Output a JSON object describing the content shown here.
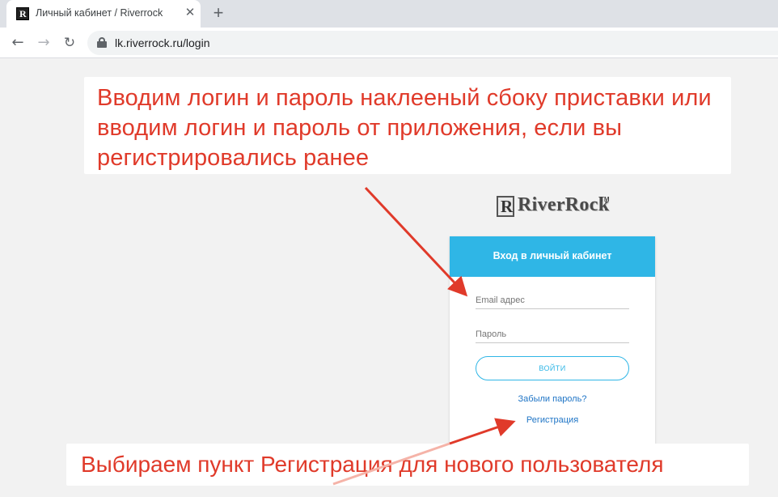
{
  "browser": {
    "tab_title": "Личный кабинет / Riverrock",
    "tab_close_glyph": "✕",
    "new_tab_glyph": "+",
    "back_glyph": "←",
    "forward_glyph": "→",
    "reload_glyph": "↻",
    "url": "lk.riverrock.ru/login"
  },
  "annotations": {
    "top_text": "Вводим логин и пароль наклееный сбоку приставки или вводим логин и пароль от приложения, если вы регистрировались ранее",
    "bottom_text": "Выбираем пункт Регистрация для нового пользователя",
    "color": "#e03a2a"
  },
  "logo": {
    "text": "RiverRock",
    "tm": "TM"
  },
  "login_card": {
    "header": "Вход в личный кабинет",
    "email_placeholder": "Email адрес",
    "password_placeholder": "Пароль",
    "submit_label": "ВОЙТИ",
    "forgot_link": "Забыли пароль?",
    "register_link": "Регистрация",
    "accent_color": "#2fb6e6",
    "link_color": "#1f75c6"
  }
}
